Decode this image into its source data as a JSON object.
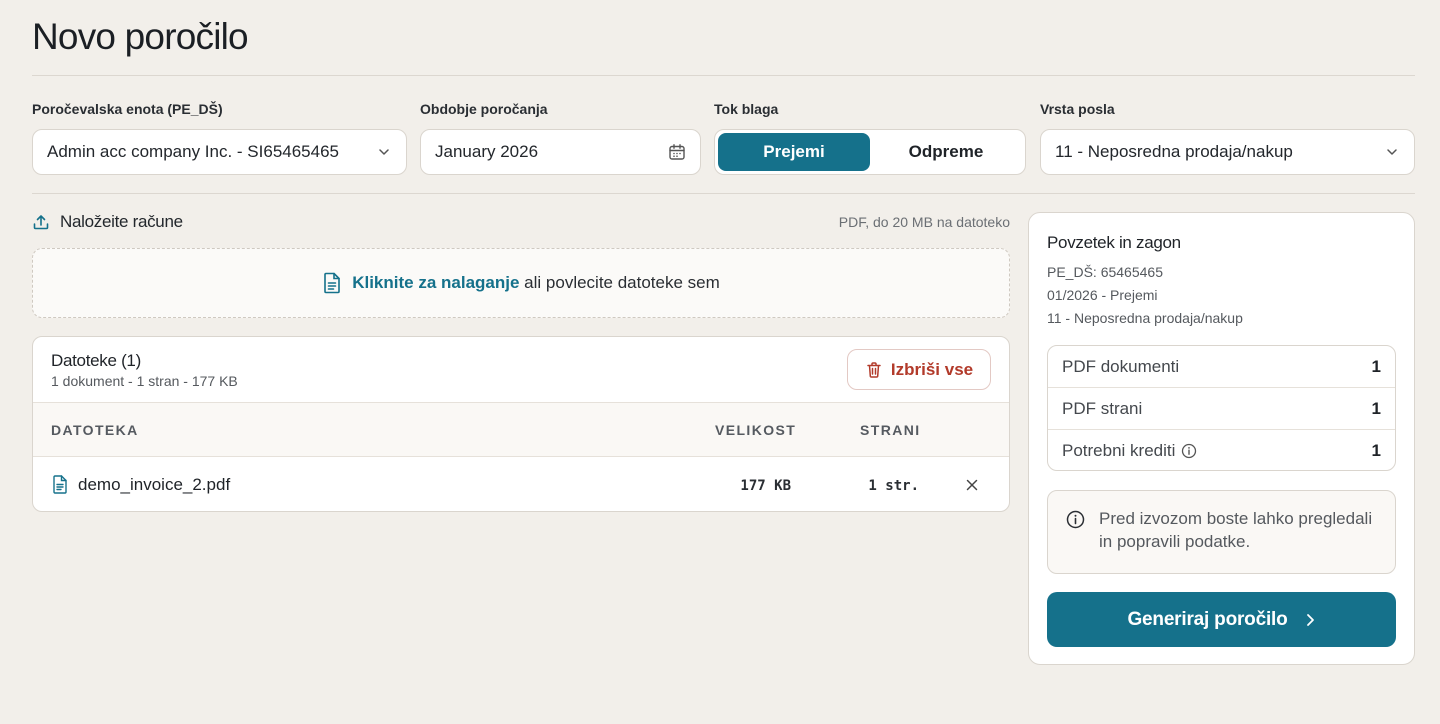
{
  "page": {
    "title": "Novo poročilo"
  },
  "filters": {
    "unit": {
      "label": "Poročevalska enota (PE_DŠ)",
      "value": "Admin acc company Inc. - SI65465465"
    },
    "period": {
      "label": "Obdobje poročanja",
      "value": "January 2026"
    },
    "flow": {
      "label": "Tok blaga",
      "options": [
        "Prejemi",
        "Odpreme"
      ],
      "selected": "Prejemi"
    },
    "type": {
      "label": "Vrsta posla",
      "value": "11 - Neposredna prodaja/nakup"
    }
  },
  "upload": {
    "heading": "Naložeite račune",
    "hint": "PDF, do 20 MB na datoteko",
    "link_text": "Kliknite za nalaganje",
    "rest_text": "ali povlecite datoteke sem"
  },
  "files": {
    "title": "Datoteke (1)",
    "summary": "1 dokument - 1 stran - 177 KB",
    "delete_all": "Izbriši vse",
    "columns": [
      "DATOTEKA",
      "VELIKOST",
      "STRANI"
    ],
    "rows": [
      {
        "name": "demo_invoice_2.pdf",
        "size": "177 KB",
        "pages": "1 str."
      }
    ]
  },
  "summary": {
    "title": "Povzetek in zagon",
    "lines": [
      "PE_DŠ: 65465465",
      "01/2026 - Prejemi",
      "11 - Neposredna prodaja/nakup"
    ],
    "stats": [
      {
        "label": "PDF dokumenti",
        "value": "1"
      },
      {
        "label": "PDF strani",
        "value": "1"
      },
      {
        "label": "Potrebni krediti",
        "value": "1"
      }
    ],
    "note": "Pred izvozom boste lahko pregledali in popravili podatke.",
    "generate": "Generiraj poročilo"
  },
  "colors": {
    "accent": "#15718b",
    "danger": "#b23a2a",
    "background": "#f2efea"
  }
}
